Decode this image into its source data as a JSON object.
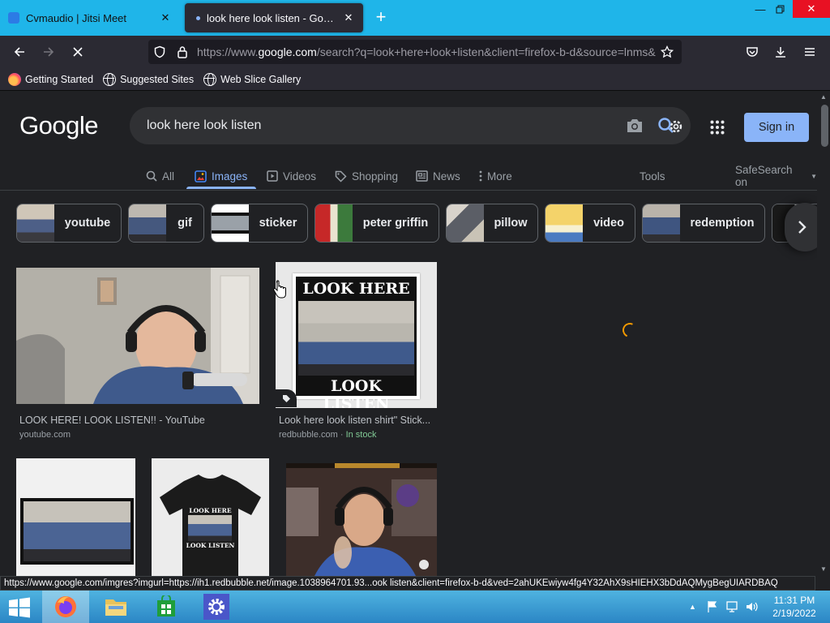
{
  "browser": {
    "tabs": [
      {
        "title": "Cvmaudio | Jitsi Meet",
        "active": false
      },
      {
        "title": "look here look listen - Google Search",
        "active": true
      }
    ],
    "url_prefix": "https://www.",
    "url_host": "google.com",
    "url_rest": "/search?q=look+here+look+listen&client=firefox-b-d&source=lnms&tbm=isch&sa=X",
    "bookmarks": [
      "Getting Started",
      "Suggested Sites",
      "Web Slice Gallery"
    ]
  },
  "google": {
    "logo": "Google",
    "query": "look here look listen",
    "signin_label": "Sign in",
    "tabs": [
      "All",
      "Images",
      "Videos",
      "Shopping",
      "News",
      "More"
    ],
    "tools_label": "Tools",
    "safesearch_label": "SafeSearch on",
    "chips": [
      "youtube",
      "gif",
      "sticker",
      "peter griffin",
      "pillow",
      "video",
      "redemption"
    ],
    "results": [
      {
        "title": "LOOK HERE! LOOK LISTEN!! - YouTube",
        "source": "youtube.com"
      },
      {
        "title": "Look here look listen shirt\" Stick...",
        "source": "redbubble.com",
        "stock": "In stock"
      }
    ],
    "sticker_top": "LOOK HERE",
    "sticker_bottom": "LOOK LISTEN",
    "shirt_top": "LOOK HERE",
    "shirt_bottom": "LOOK LISTEN"
  },
  "status_url": "https://www.google.com/imgres?imgurl=https://ih1.redbubble.net/image.1038964701.93...ook listen&client=firefox-b-d&ved=2ahUKEwiyw4fg4Y32AhX9sHIEHX3bDdAQMygBegUIARDBAQ",
  "taskbar": {
    "time": "11:31 PM",
    "date": "2/19/2022"
  },
  "colors": {
    "accent": "#8ab4f8",
    "tabstrip": "#1fb5e9",
    "page_bg": "#202124"
  }
}
